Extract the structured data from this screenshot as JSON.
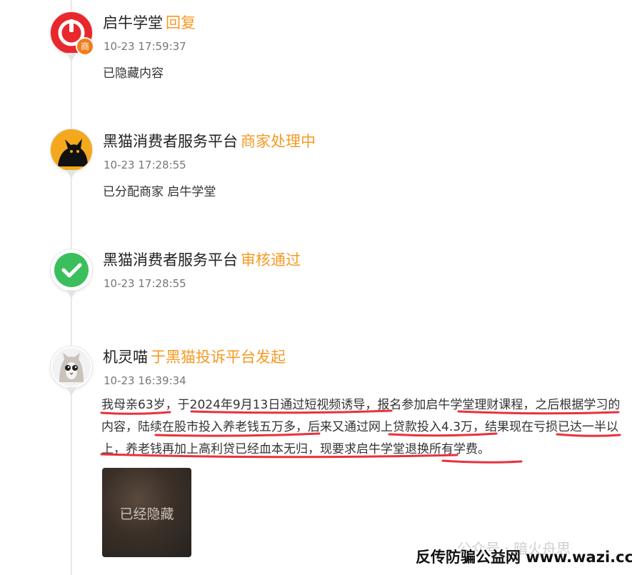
{
  "timeline": [
    {
      "actor": "启牛学堂",
      "action": "回复",
      "time": "10-23 17:59:37",
      "content": "已隐藏内容",
      "avatar_icon": "power-logo-icon",
      "badge": "商"
    },
    {
      "actor": "黑猫消费者服务平台",
      "action": "商家处理中",
      "time": "10-23 17:28:55",
      "content": "已分配商家 启牛学堂",
      "avatar_icon": "black-cat-icon"
    },
    {
      "actor": "黑猫消费者服务平台",
      "action": "审核通过",
      "time": "10-23 17:28:55",
      "avatar_icon": "checkmark-icon"
    },
    {
      "actor": "机灵喵",
      "action": "于黑猫投诉平台发起",
      "time": "10-23 16:39:34",
      "content": "我母亲63岁，于2024年9月13日通过短视频诱导，报名参加启牛学堂理财课程，之后根据学习的内容，陆续在股市投入养老钱五万多，后来又通过网上贷款投入4.3万，结果现在亏损已达一半以上，养老钱再加上高利贷已经血本无归，现要求启牛学堂退换所有学费。",
      "avatar_icon": "cat-avatar-icon",
      "attachment_label": "已经隐藏"
    }
  ],
  "watermark": {
    "faint": "公众号 · 暗火舟思",
    "main": "反传防骗公益网 www.wazi.cc"
  },
  "colors": {
    "action": "#f59a23",
    "underline": "#e8323c",
    "check_green": "#3bbf5c",
    "logo_red": "#e8282c"
  }
}
